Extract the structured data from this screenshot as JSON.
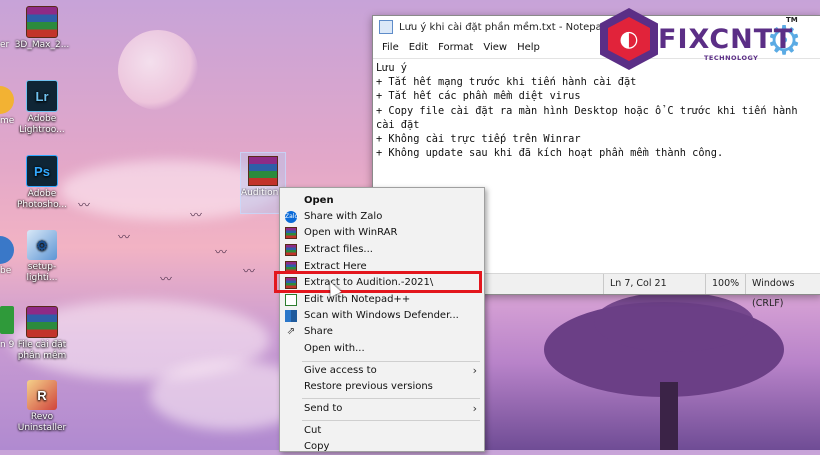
{
  "desktop": {
    "icons": [
      {
        "label": "3D_Max_2...",
        "left": 0
      },
      {
        "label": "Adobe Lightroo...",
        "left": 0
      },
      {
        "label": "Adobe Photosho...",
        "left": 0
      },
      {
        "label": "setup-lighti...",
        "left": 0
      },
      {
        "label": "File cài đặt phần mềm",
        "left": 0
      },
      {
        "label": "Revo Uninstaller",
        "left": 0
      }
    ],
    "partial_labels": [
      "er",
      "me",
      "be",
      "n 9"
    ],
    "selected_icon_label": "Audition ... 21.rar"
  },
  "notepad": {
    "title": "Lưu ý khi cài đặt phần mềm.txt - Notepad",
    "menu": [
      "File",
      "Edit",
      "Format",
      "View",
      "Help"
    ],
    "content": "Lưu ý\n+ Tắt hết mạng trước khi tiến hành cài đặt\n+ Tắt hết các phần mềm diệt virus\n+ Copy file cài đặt ra màn hình Desktop hoặc ổ C trước khi tiến hành cài đặt\n+ Không cài trực tiếp trên Winrar\n+ Không update sau khi đã kích hoạt phần mềm thành công.",
    "status": {
      "position": "Ln 7, Col 21",
      "zoom": "100%",
      "line_ending": "Windows (CRLF)"
    }
  },
  "logo": {
    "name": "FIXCNTT",
    "subtitle": "TECHNOLOGY",
    "tm": "TM"
  },
  "context_menu": {
    "items": [
      {
        "label": "Open",
        "bold": true
      },
      {
        "label": "Share with Zalo"
      },
      {
        "label": "Open with WinRAR"
      },
      {
        "label": "Extract files..."
      },
      {
        "label": "Extract Here"
      },
      {
        "label": "Extract to Audition.-2021\\",
        "highlighted": true
      },
      {
        "label": "Edit with Notepad++"
      },
      {
        "label": "Scan with Windows Defender..."
      },
      {
        "label": "Share"
      },
      {
        "label": "Open with..."
      },
      {
        "label": "Give access to",
        "submenu": true
      },
      {
        "label": "Restore previous versions"
      },
      {
        "label": "Send to",
        "submenu": true
      },
      {
        "label": "Cut"
      },
      {
        "label": "Copy"
      }
    ]
  },
  "colors": {
    "highlight_border": "#e3161d",
    "logo_purple": "#5b2e86",
    "logo_red": "#e1233a"
  }
}
